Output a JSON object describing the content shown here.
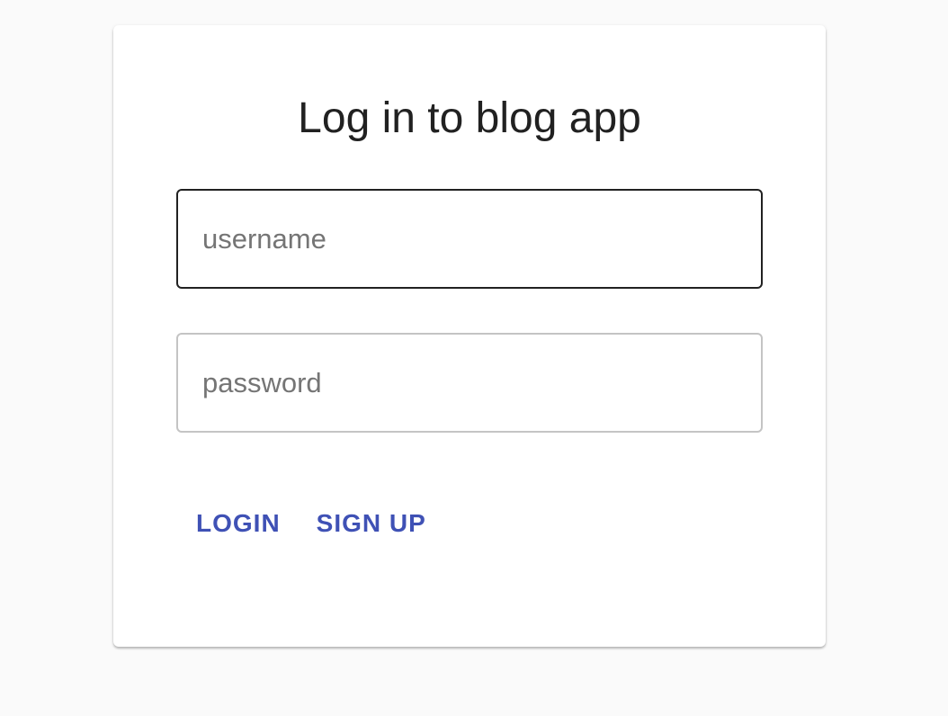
{
  "login_form": {
    "title": "Log in to blog app",
    "username": {
      "placeholder": "username",
      "value": ""
    },
    "password": {
      "placeholder": "password",
      "value": ""
    },
    "actions": {
      "login_label": "LOGIN",
      "signup_label": "SIGN UP"
    }
  },
  "colors": {
    "page_background": "#fafafa",
    "card_background": "#ffffff",
    "accent": "#3f51b5",
    "focused_border": "#212121",
    "idle_border": "#c4c4c4"
  }
}
